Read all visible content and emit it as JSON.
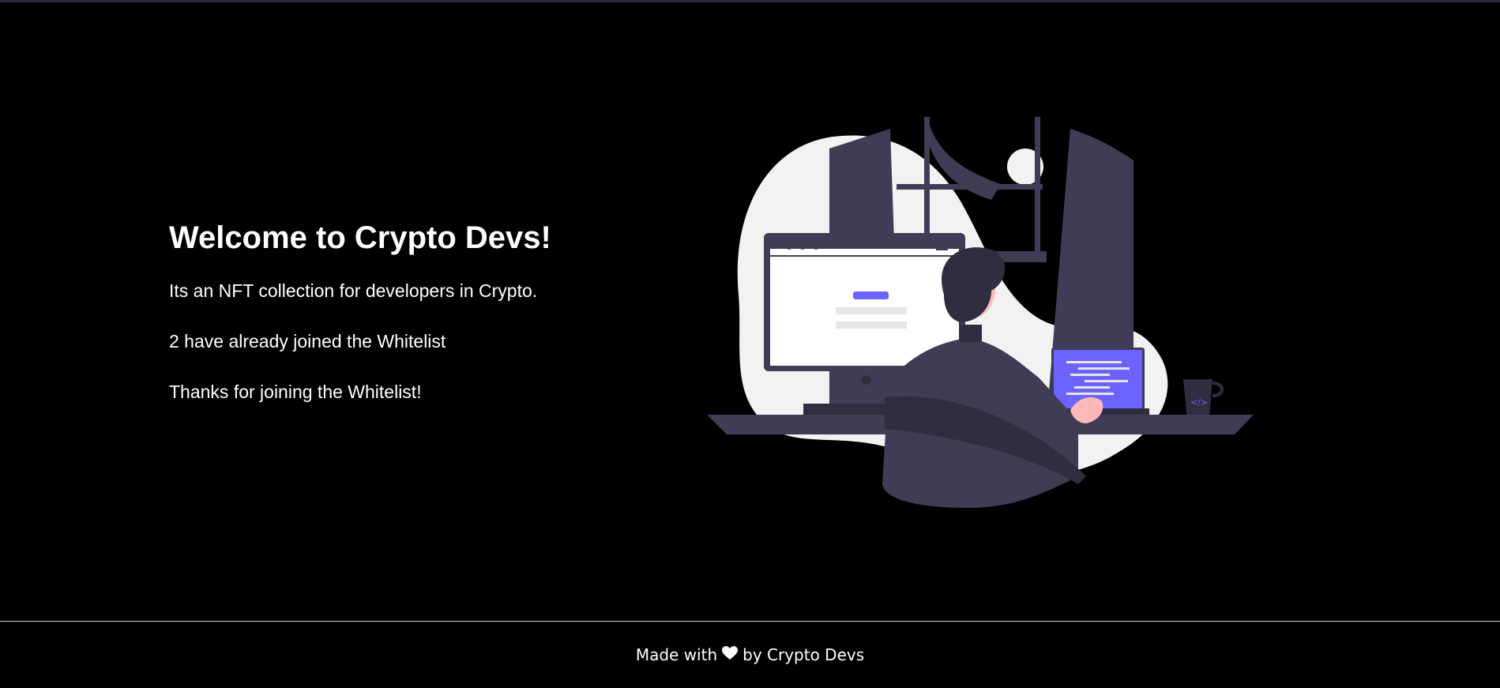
{
  "hero": {
    "title": "Welcome to Crypto Devs!",
    "description": "Its an NFT collection for developers in Crypto.",
    "whitelist_count_text": "2 have already joined the Whitelist",
    "status_message": "Thanks for joining the Whitelist!"
  },
  "illustration": {
    "icon": "developer-at-desk-illustration",
    "accent_color": "#6c63ff",
    "dark_color": "#3f3d56"
  },
  "footer": {
    "prefix": "Made with",
    "icon": "heart-icon",
    "suffix": "by Crypto Devs"
  }
}
